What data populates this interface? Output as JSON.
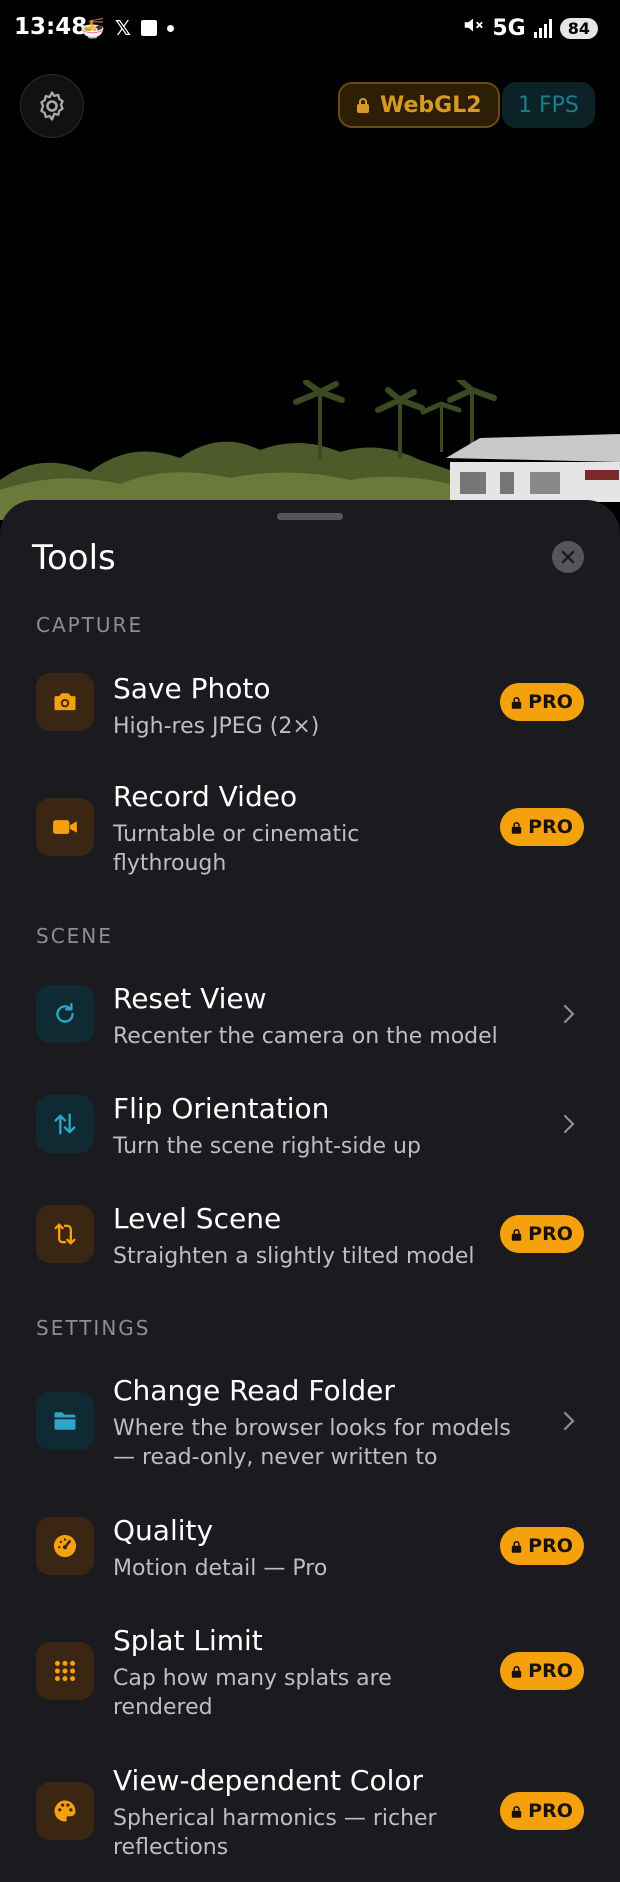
{
  "status_bar": {
    "time": "13:48",
    "network": "5G",
    "battery": "84"
  },
  "viewer": {
    "renderer_badge": "WebGL2",
    "fps_badge": "1 FPS"
  },
  "sheet": {
    "title": "Tools",
    "sections": {
      "capture": "CAPTURE",
      "scene": "SCENE",
      "settings": "SETTINGS"
    },
    "items": {
      "save_photo": {
        "title": "Save Photo",
        "subtitle": "High-res JPEG (2×)",
        "badge": "PRO",
        "icon": "camera-icon"
      },
      "record_video": {
        "title": "Record Video",
        "subtitle": "Turntable or cinematic flythrough",
        "badge": "PRO",
        "icon": "video-icon"
      },
      "reset_view": {
        "title": "Reset View",
        "subtitle": "Recenter the camera on the model",
        "icon": "refresh-icon"
      },
      "flip_orientation": {
        "title": "Flip Orientation",
        "subtitle": "Turn the scene right-side up",
        "icon": "swap-vertical-icon"
      },
      "level_scene": {
        "title": "Level Scene",
        "subtitle": "Straighten a slightly tilted model",
        "badge": "PRO",
        "icon": "level-icon"
      },
      "change_read_folder": {
        "title": "Change Read Folder",
        "subtitle": "Where the browser looks for models — read-only, never written to",
        "icon": "folder-icon"
      },
      "quality": {
        "title": "Quality",
        "subtitle": "Motion detail — Pro",
        "badge": "PRO",
        "icon": "speedometer-icon"
      },
      "splat_limit": {
        "title": "Splat Limit",
        "subtitle": "Cap how many splats are rendered",
        "badge": "PRO",
        "icon": "grid-dots-icon"
      },
      "view_dependent_color": {
        "title": "View-dependent Color",
        "subtitle": "Spherical harmonics — richer reflections",
        "badge": "PRO",
        "icon": "palette-icon"
      }
    }
  },
  "colors": {
    "accent_orange": "#f5a10d",
    "accent_teal": "#2ba7c7",
    "sheet_bg": "#1a1a1f"
  }
}
